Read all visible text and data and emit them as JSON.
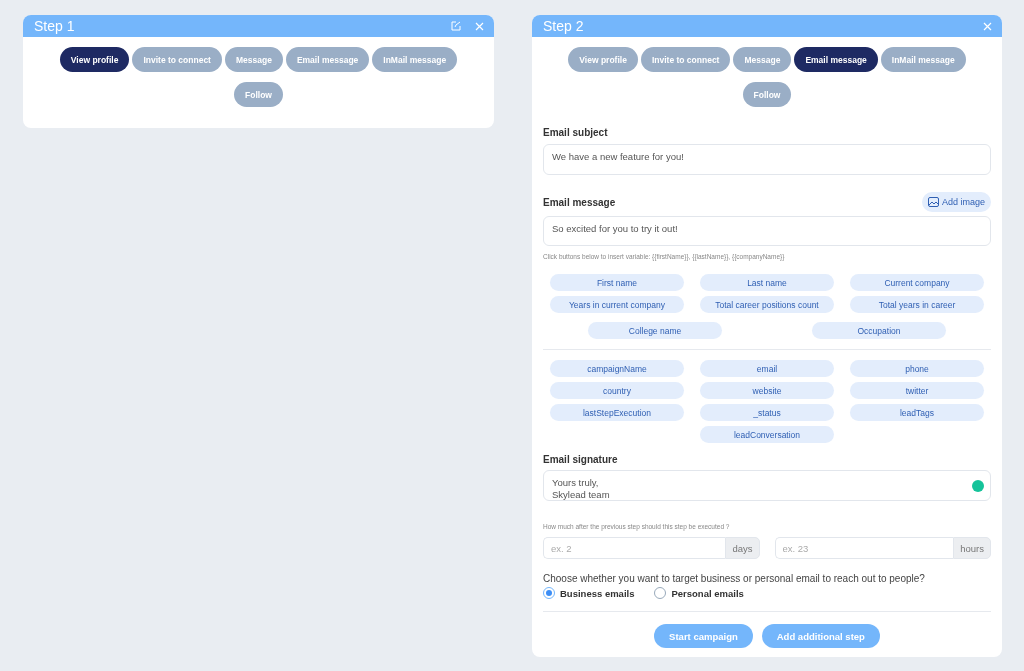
{
  "steps": [
    {
      "title": "Step 1",
      "editable": true,
      "actions": [
        {
          "label": "View profile",
          "selected": true
        },
        {
          "label": "Invite to connect",
          "selected": false
        },
        {
          "label": "Message",
          "selected": false
        },
        {
          "label": "Email message",
          "selected": false
        },
        {
          "label": "InMail message",
          "selected": false
        },
        {
          "label": "Follow",
          "selected": false
        }
      ]
    },
    {
      "title": "Step 2",
      "editable": false,
      "actions": [
        {
          "label": "View profile",
          "selected": false
        },
        {
          "label": "Invite to connect",
          "selected": false
        },
        {
          "label": "Message",
          "selected": false
        },
        {
          "label": "Email message",
          "selected": true
        },
        {
          "label": "InMail message",
          "selected": false
        },
        {
          "label": "Follow",
          "selected": false
        }
      ],
      "email": {
        "subject": {
          "label": "Email subject",
          "value": "We have a new feature for you!"
        },
        "message": {
          "label": "Email message",
          "add_image": "Add image",
          "value": "So excited for you to try it out!",
          "hint": "Click buttons below to insert variable: {{firstName}}, {{lastName}}, {{companyName}}"
        },
        "variable_groups": [
          [
            [
              "First name",
              "Last name",
              "Current company"
            ],
            [
              "Years in current company",
              "Total career positions count",
              "Total years in career"
            ],
            [
              "College name",
              "Occupation"
            ]
          ],
          [
            [
              "campaignName",
              "email",
              "phone"
            ],
            [
              "country",
              "website",
              "twitter"
            ],
            [
              "lastStepExecution",
              "_status",
              "leadTags"
            ],
            [
              "leadConversation"
            ]
          ]
        ],
        "signature": {
          "label": "Email signature",
          "value": "Yours truly,\nSkylead team"
        },
        "delay": {
          "hint": "How much after the previous step should this step be executed ?",
          "fields": [
            {
              "placeholder": "ex. 2",
              "unit": "days"
            },
            {
              "placeholder": "ex. 23",
              "unit": "hours"
            }
          ]
        },
        "target": {
          "question": "Choose whether you want to target business or personal email to reach out to people?",
          "options": [
            {
              "label": "Business emails",
              "selected": true
            },
            {
              "label": "Personal emails",
              "selected": false
            }
          ]
        },
        "buttons": [
          "Start campaign",
          "Add additional step"
        ]
      }
    }
  ]
}
